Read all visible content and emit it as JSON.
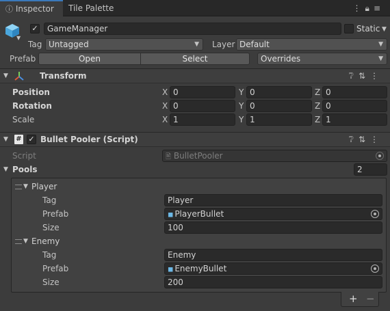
{
  "tabs": [
    {
      "label": "Inspector",
      "icon": "info-icon"
    },
    {
      "label": "Tile Palette"
    }
  ],
  "object": {
    "name": "GameManager",
    "static_label": "Static",
    "tag_label": "Tag",
    "tag_value": "Untagged",
    "layer_label": "Layer",
    "layer_value": "Default",
    "prefab_label": "Prefab",
    "open_label": "Open",
    "select_label": "Select",
    "overrides_label": "Overrides"
  },
  "transform": {
    "title": "Transform",
    "rows": [
      {
        "label": "Position",
        "x": "0",
        "y": "0",
        "z": "0"
      },
      {
        "label": "Rotation",
        "x": "0",
        "y": "0",
        "z": "0"
      },
      {
        "label": "Scale",
        "x": "1",
        "y": "1",
        "z": "1"
      }
    ]
  },
  "axes": {
    "x": "X",
    "y": "Y",
    "z": "Z"
  },
  "script_component": {
    "title": "Bullet Pooler (Script)",
    "script_label": "Script",
    "script_value": "BulletPooler",
    "pools_label": "Pools",
    "pools_count": "2",
    "pools": [
      {
        "name": "Player",
        "tag_label": "Tag",
        "tag": "Player",
        "prefab_label": "Prefab",
        "prefab": "PlayerBullet",
        "size_label": "Size",
        "size": "100"
      },
      {
        "name": "Enemy",
        "tag_label": "Tag",
        "tag": "Enemy",
        "prefab_label": "Prefab",
        "prefab": "EnemyBullet",
        "size_label": "Size",
        "size": "200"
      }
    ]
  },
  "list_buttons": {
    "add": "+",
    "remove": "−"
  }
}
